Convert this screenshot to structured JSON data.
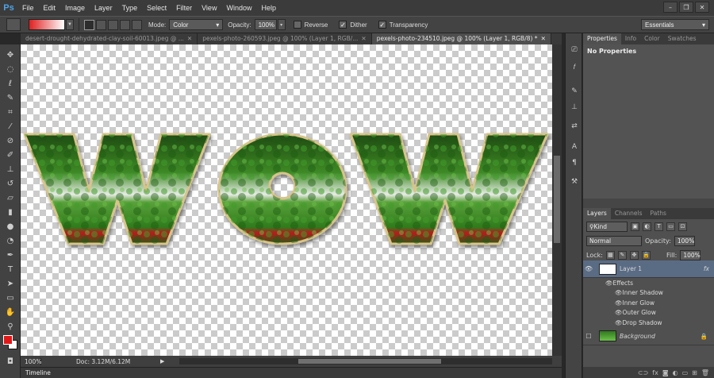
{
  "app": {
    "logo": "Ps"
  },
  "menu": [
    "File",
    "Edit",
    "Image",
    "Layer",
    "Type",
    "Select",
    "Filter",
    "View",
    "Window",
    "Help"
  ],
  "window_buttons": [
    "minimize",
    "restore",
    "close"
  ],
  "options_bar": {
    "mode_label": "Mode:",
    "mode_value": "Color",
    "opacity_label": "Opacity:",
    "opacity_value": "100%",
    "reverse_label": "Reverse",
    "reverse_checked": false,
    "dither_label": "Dither",
    "dither_checked": true,
    "transparency_label": "Transparency",
    "transparency_checked": true,
    "workspace": "Essentials"
  },
  "tabs": [
    {
      "label": "desert-drought-dehydrated-clay-soil-60013.jpeg @ ...",
      "active": false
    },
    {
      "label": "pexels-photo-260593.jpeg @ 100% (Layer 1, RGB/...",
      "active": false
    },
    {
      "label": "pexels-photo-234510.jpeg @ 100% (Layer 1, RGB/8) *",
      "active": true
    }
  ],
  "canvas": {
    "text": "WOW"
  },
  "status": {
    "zoom": "100%",
    "doc": "Doc: 3.12M/6.12M"
  },
  "timeline_label": "Timeline",
  "properties": {
    "tabs": [
      "Properties",
      "Info",
      "Color",
      "Swatches"
    ],
    "body": "No Properties"
  },
  "layers": {
    "tabs": [
      "Layers",
      "Channels",
      "Paths"
    ],
    "filter": "Kind",
    "blend": "Normal",
    "opacity_label": "Opacity:",
    "opacity": "100%",
    "lock_label": "Lock:",
    "fill_label": "Fill:",
    "fill": "100%",
    "items": [
      {
        "name": "Layer 1",
        "selected": true,
        "fx": "fx"
      },
      {
        "name": "Background",
        "selected": false
      }
    ],
    "effects_label": "Effects",
    "effects": [
      "Inner Shadow",
      "Inner Glow",
      "Outer Glow",
      "Drop Shadow"
    ]
  },
  "colors": {
    "foreground": "#e01818",
    "background": "#ffffff",
    "accent": "#5a6b84"
  }
}
